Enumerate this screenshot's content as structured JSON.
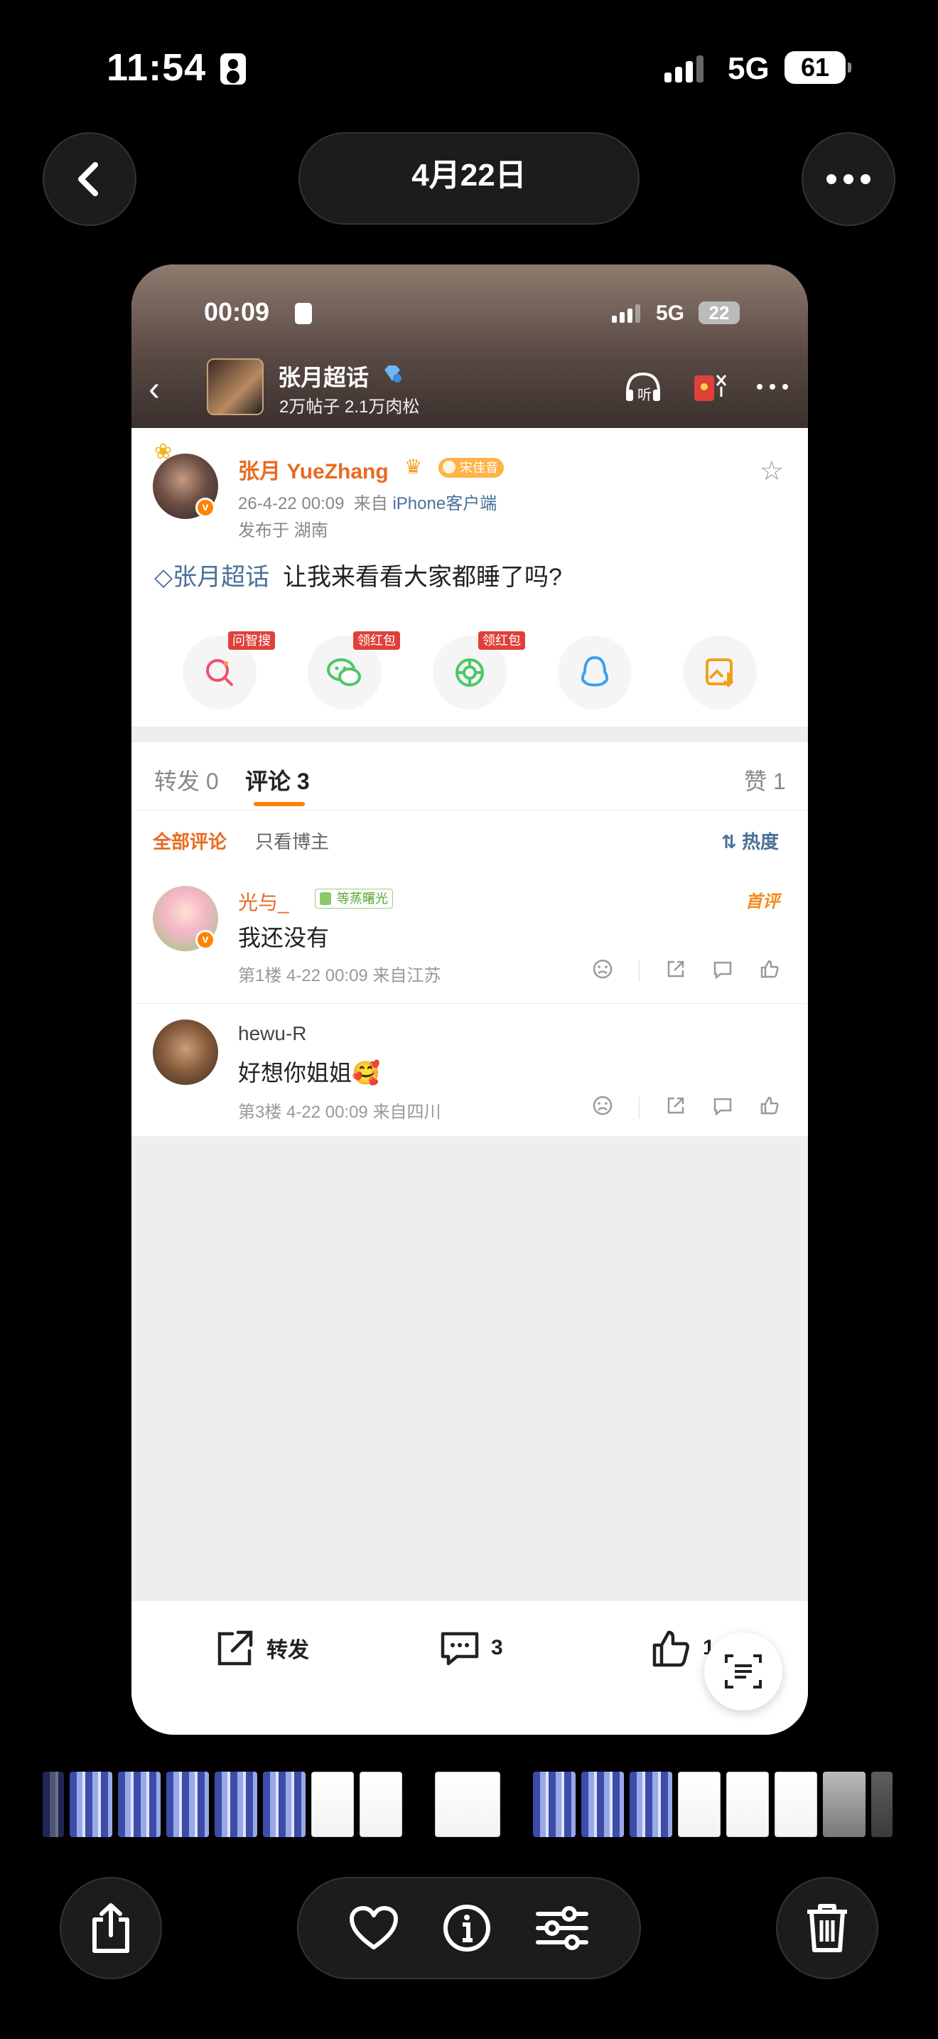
{
  "os_status": {
    "time": "11:54",
    "network": "5G",
    "battery": "61"
  },
  "viewer": {
    "date_title": "4月22日"
  },
  "inner_status": {
    "time": "00:09",
    "network": "5G",
    "battery": "22"
  },
  "topic": {
    "name": "张月超话",
    "stats": "2万帖子 2.1万肉松",
    "listen_label": "听"
  },
  "post": {
    "author": "张月 YueZhang",
    "fan_badge": "宋佳音",
    "meta_time": "26-4-22 00:09",
    "meta_from": "来自",
    "meta_device": "iPhone客户端",
    "location": "发布于 湖南",
    "tag": "张月超话",
    "text": "让我来看看大家都睡了吗?",
    "share_tags": [
      "问智搜",
      "领红包",
      "领红包"
    ]
  },
  "tabs": {
    "repost": "转发 0",
    "comments": "评论 3",
    "likes": "赞 1"
  },
  "filter": {
    "all": "全部评论",
    "owner_only": "只看博主",
    "sort": "热度"
  },
  "comments": [
    {
      "name": "光与_",
      "level": "等蒸曙光",
      "text": "我还没有",
      "meta": "第1楼 4-22 00:09 来自江苏",
      "badge": "首评"
    },
    {
      "name": "hewu-R",
      "text": "好想你姐姐",
      "emoji": "🥰",
      "meta": "第3楼 4-22 00:09 来自四川"
    }
  ],
  "bottom_bar": {
    "repost": "转发",
    "comments": "3",
    "likes": "1"
  },
  "colors": {
    "accent": "#ff8200",
    "link": "#4a6f9a",
    "tag_red": "#e0403a"
  }
}
